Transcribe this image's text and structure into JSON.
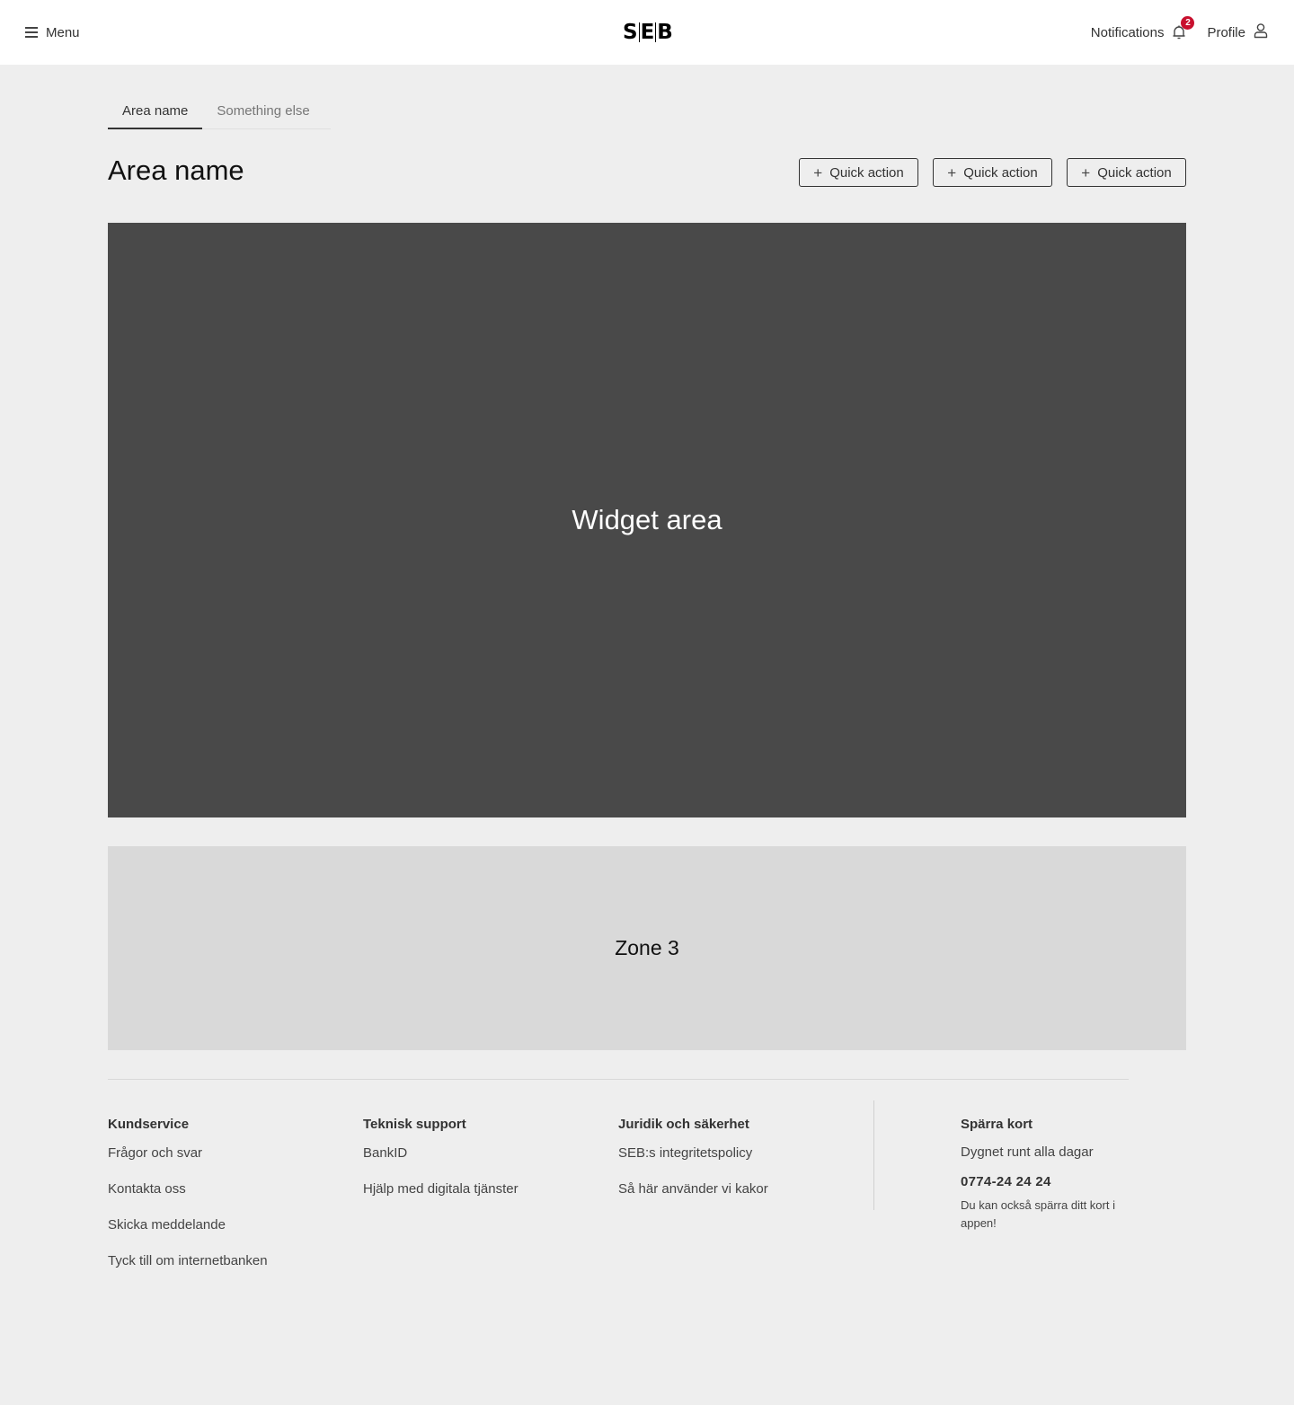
{
  "header": {
    "menu_label": "Menu",
    "logo_letters": [
      "S",
      "E",
      "B"
    ],
    "notifications_label": "Notifications",
    "notifications_count": "2",
    "profile_label": "Profile",
    "badge_color": "#c8102e"
  },
  "tabs": [
    {
      "label": "Area name",
      "active": true
    },
    {
      "label": "Something else",
      "active": false
    }
  ],
  "page": {
    "title": "Area name",
    "quick_actions": [
      {
        "label": "Quick action"
      },
      {
        "label": "Quick action"
      },
      {
        "label": "Quick action"
      }
    ]
  },
  "widget": {
    "label": "Widget area"
  },
  "zone3": {
    "label": "Zone 3"
  },
  "footer": {
    "columns": [
      {
        "heading": "Kundservice",
        "links": [
          "Frågor och svar",
          "Kontakta oss",
          "Skicka meddelande",
          "Tyck till om internetbanken"
        ]
      },
      {
        "heading": "Teknisk support",
        "links": [
          "BankID",
          "Hjälp med digitala tjänster"
        ]
      },
      {
        "heading": "Juridik och säkerhet",
        "links": [
          "SEB:s integritetspolicy",
          "Så här använder vi kakor"
        ]
      }
    ],
    "block_card": {
      "heading": "Spärra kort",
      "availability": "Dygnet runt alla dagar",
      "phone": "0774-24 24 24",
      "note": "Du kan också spärra ditt kort i appen!"
    }
  }
}
